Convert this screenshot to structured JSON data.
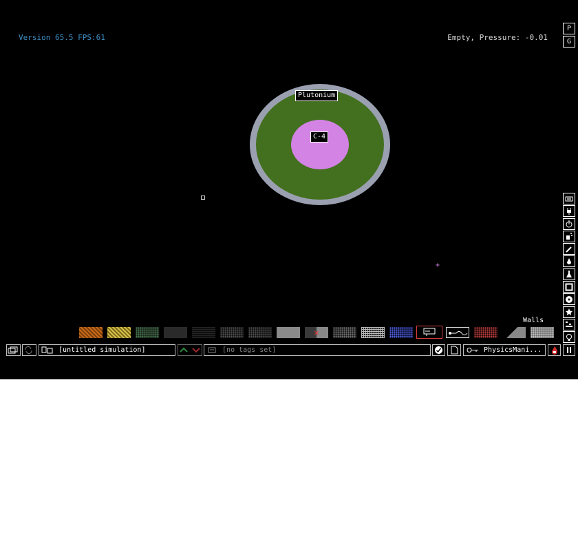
{
  "hud": {
    "version_text": "Version 65.5 FPS:61",
    "pressure_text": "Empty, Pressure: -0.01"
  },
  "top_right_buttons": {
    "p_label": "P",
    "g_label": "G"
  },
  "canvas": {
    "labels": {
      "outer": "Plutonium",
      "inner": "C-4"
    }
  },
  "element_panel": {
    "category": "Walls",
    "erase_marker": "✕"
  },
  "bottom_bar": {
    "title": "[untitled simulation]",
    "tags": "[no tags set]",
    "user": "PhysicsMani..."
  },
  "colors": {
    "version": "#3f8fc4",
    "plutonium": "#43701f",
    "c4": "#d383e4",
    "ring": "#9aa0b0",
    "selected_border": "#e04040",
    "vote_up": "#2d8a3c",
    "vote_down": "#a02a2a"
  },
  "icons": {
    "menu": [
      "keyboard-icon",
      "plug-icon",
      "power-icon",
      "spray-icon",
      "pipette-icon",
      "drop-icon",
      "flask-icon",
      "wall-icon",
      "radiation-icon",
      "star-icon",
      "gear-dots-icon",
      "bulb-icon"
    ]
  }
}
